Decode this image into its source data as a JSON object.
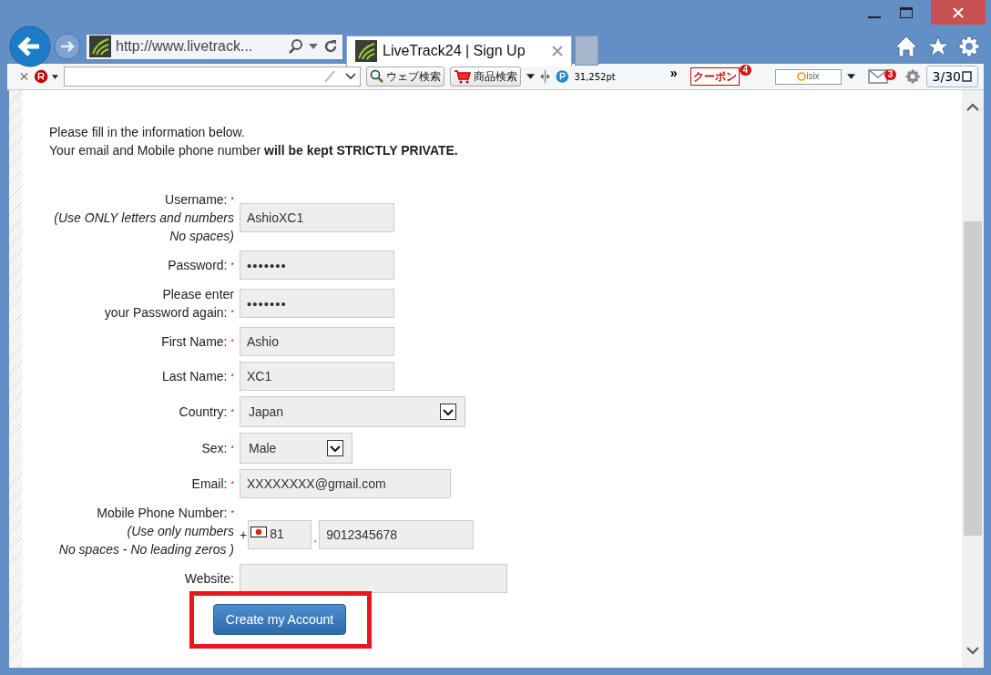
{
  "address_bar": {
    "url": "http://www.livetrack..."
  },
  "tab": {
    "title": "LiveTrack24 | Sign Up",
    "selected": true
  },
  "toolbar": {
    "web_search": "ウェブ検索",
    "shop_search": "商品検索",
    "points": "31,252pt",
    "more": "»",
    "coupon": "クーポン",
    "coupon_count": "4",
    "logo": "isix",
    "mail_count": "3",
    "date": "3/30"
  },
  "intro": [
    "Please fill in the information below.",
    "Your email and Mobile phone number **will be kept STRICTLY PRIVATE.**"
  ],
  "fields": [
    {
      "kind": "text",
      "label": "Username:",
      "required_mark": "*",
      "hint": [
        "(Use ONLY letters and numbers",
        "No spaces)"
      ],
      "value": "AshioXC1"
    },
    {
      "kind": "text",
      "label": "Password:",
      "required_mark": "*",
      "value": "•••••••"
    },
    {
      "kind": "text",
      "label": "Please enter",
      "label_2": "your Password again:",
      "required_mark": "*",
      "value": "•••••••"
    },
    {
      "kind": "text",
      "label": "First Name:",
      "required_mark": "*",
      "value": "Ashio"
    },
    {
      "kind": "text",
      "label": "Last Name:",
      "required_mark": "*",
      "value": "XC1"
    },
    {
      "kind": "select",
      "label": "Country:",
      "required_mark": "*",
      "value": "Japan"
    },
    {
      "kind": "shortselect",
      "label": "Sex:",
      "required_mark": "*",
      "value": "Male"
    },
    {
      "kind": "email",
      "label": "Email:",
      "required_mark": "*",
      "value": "XXXXXXXX@gmail.com"
    },
    {
      "kind": "phone",
      "label": "Mobile Phone Number:",
      "required_mark": "*",
      "hint": [
        "(Use only numbers",
        "No spaces - No leading zeros )"
      ],
      "plus": "+",
      "code": "81",
      "separator": ".",
      "value": "9012345678"
    },
    {
      "kind": "url",
      "label": "Website:"
    }
  ],
  "submit": {
    "label": "Create my Account",
    "highlighted": true
  }
}
